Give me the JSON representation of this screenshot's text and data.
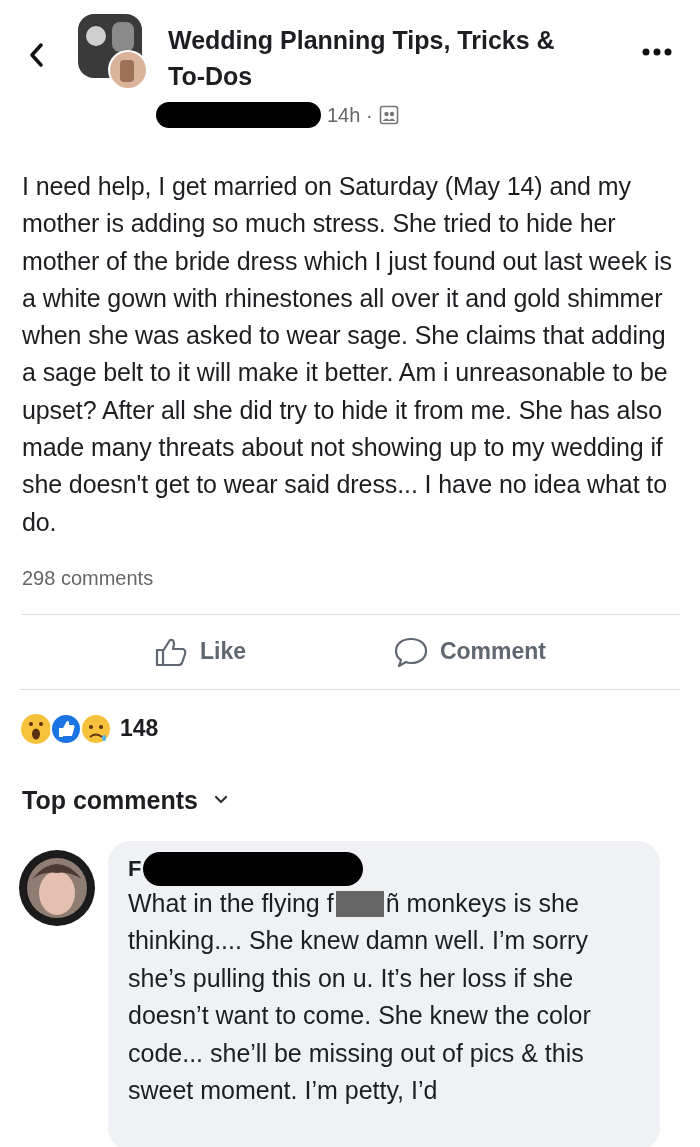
{
  "header": {
    "group_name": "Wedding Planning Tips, Tricks & To-Dos",
    "time": "14h ·"
  },
  "post": {
    "text": "I need help, I get married on Saturday (May 14) and my mother is adding so much stress. She tried to hide her mother of the bride dress which I just found out last week is a white gown with rhinestones all over it and gold shimmer when she was asked to wear sage. She claims that adding a sage belt to it will make it better. Am i unreasonable to be upset? After all she did try to hide it from me. She has also made many threats about not showing up to my wedding if she doesn't get to wear said dress... I have no idea what to do.",
    "comments_count": "298 comments"
  },
  "actions": [
    {
      "kind": "like",
      "label": "Like"
    },
    {
      "kind": "comment",
      "label": "Comment"
    }
  ],
  "reactions": {
    "count": "148"
  },
  "top_comments": {
    "label": "Top comments"
  },
  "comments": [
    {
      "name": "F",
      "text_before": "What in the flying f",
      "text_after": "ñ monkeys is she",
      "text_rest": "thinking.... She knew damn well. I’m sorry she’s pulling this on u. It’s her loss if she doesn’t want to come. She knew the color code... she’ll be missing out of pics & this sweet moment. I’m petty, I’d"
    }
  ]
}
